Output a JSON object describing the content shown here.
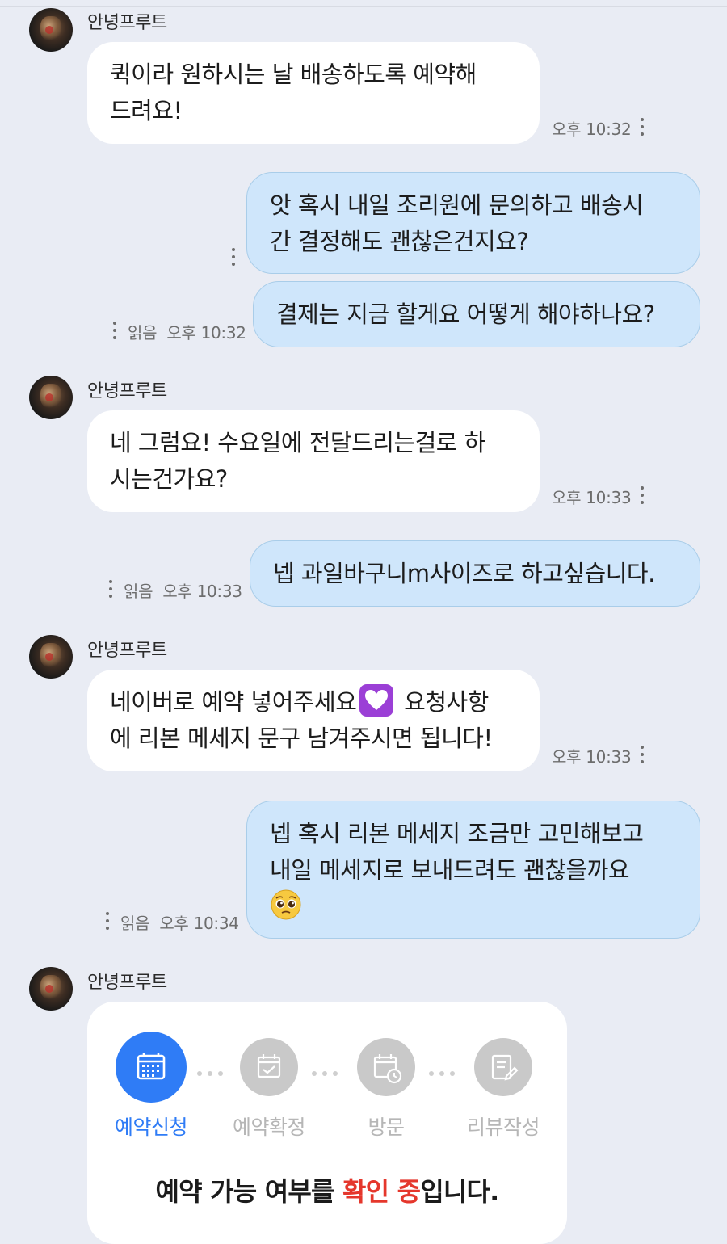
{
  "chat": {
    "sender_name": "안녕프루트",
    "messages": [
      {
        "from": "them",
        "text": "퀵이라 원하시는 날 배송하도록 예약해\n드려요!",
        "time": "오후 10:32"
      },
      {
        "from": "me",
        "text": "앗 혹시 내일 조리원에 문의하고 배송시\n간 결정해도 괜찮은건지요?",
        "time": ""
      },
      {
        "from": "me",
        "text": "결제는 지금 할게요 어떻게 해야하나요?",
        "read": "읽음",
        "time": "오후 10:32"
      },
      {
        "from": "them",
        "text": "네 그럼요! 수요일에 전달드리는걸로 하\n시는건가요?",
        "time": "오후 10:33"
      },
      {
        "from": "me",
        "text": "넵 과일바구니m사이즈로 하고싶습니다.",
        "read": "읽음",
        "time": "오후 10:33"
      },
      {
        "from": "them",
        "text_before": "네이버로 예약 넣어주세요",
        "emoji": "purple-heart-emoji",
        "text_after": " 요청사항\n에 리본 메세지 문구 남겨주시면 됩니다!",
        "time": "오후 10:33"
      },
      {
        "from": "me",
        "text": "넵 혹시 리본 메세지 조금만 고민해보고\n내일 메세지로 보내드려도 괜찮을까요",
        "emoji": "pleading-face-emoji",
        "read": "읽음",
        "time": "오후 10:34"
      }
    ]
  },
  "reservation_card": {
    "steps": [
      {
        "label": "예약신청",
        "icon": "calendar-grid-icon",
        "active": true
      },
      {
        "label": "예약확정",
        "icon": "calendar-check-icon",
        "active": false
      },
      {
        "label": "방문",
        "icon": "calendar-clock-icon",
        "active": false
      },
      {
        "label": "리뷰작성",
        "icon": "edit-note-icon",
        "active": false
      }
    ],
    "status_before": "예약 가능 여부를 ",
    "status_highlight": "확인 중",
    "status_after": "입니다."
  },
  "colors": {
    "accent": "#2f7cf6",
    "highlight": "#e5372c",
    "my_bubble": "#cfe6fb",
    "background": "#e9ecf4"
  }
}
